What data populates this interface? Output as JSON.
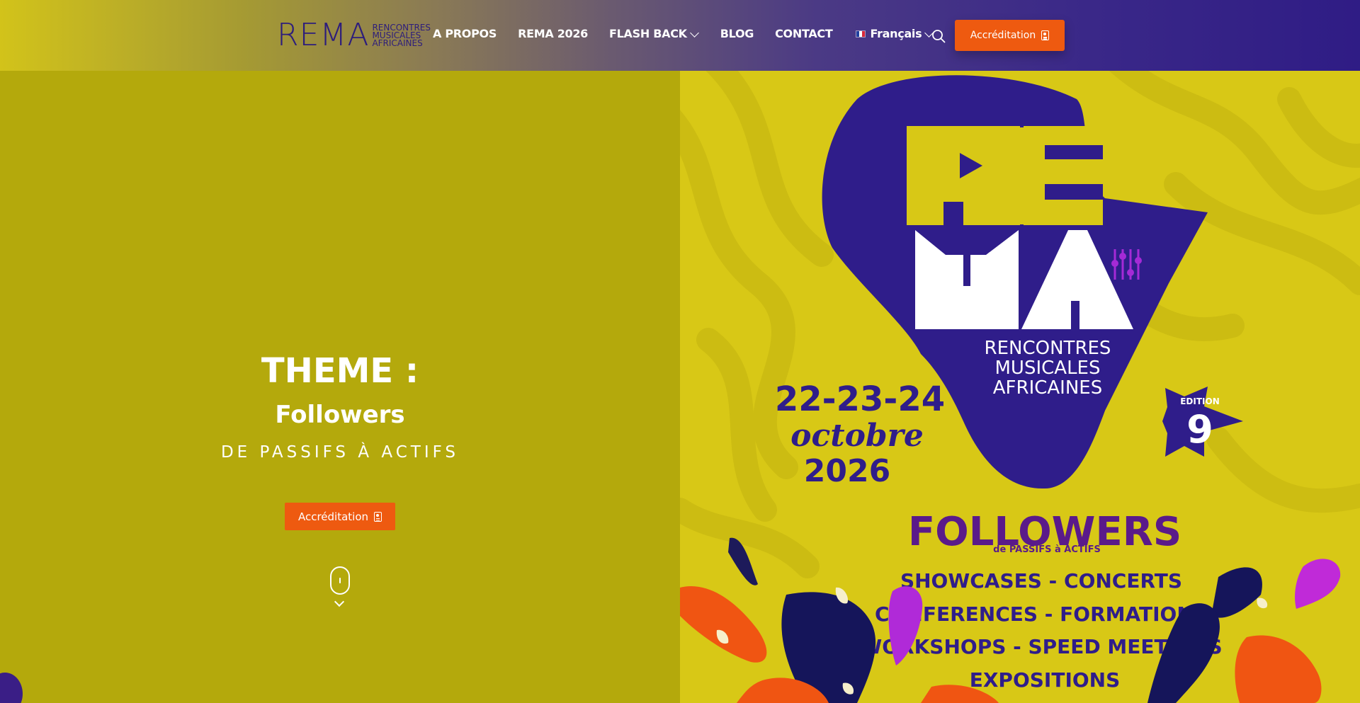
{
  "header": {
    "logo": {
      "mark": "REMA",
      "sub_lines": [
        "RENCONTRES",
        "MUSICALES",
        "AFRICAINES"
      ]
    },
    "nav": [
      {
        "label": "A PROPOS",
        "dropdown": false
      },
      {
        "label": "REMA 2026",
        "dropdown": false
      },
      {
        "label": "FLASH BACK",
        "dropdown": true
      },
      {
        "label": "BLOG",
        "dropdown": false
      },
      {
        "label": "CONTACT",
        "dropdown": false
      }
    ],
    "language": {
      "label": "Français",
      "flag": "fr-flag-icon"
    },
    "search_icon": "search-icon",
    "cta_label": "Accréditation"
  },
  "hero": {
    "title": "THEME :",
    "subtitle": "Followers",
    "tagline": "DE PASSIFS À ACTIFS",
    "cta_label": "Accréditation",
    "scroll_icon": "mouse-scroll-icon"
  },
  "poster": {
    "logo_top": "RE",
    "logo_bottom": "MA",
    "org_lines": [
      "RENCONTRES",
      "MUSICALES",
      "AFRICAINES"
    ],
    "dates": "22-23-24",
    "month": "octobre",
    "year": "2026",
    "edition_label": "EDITION",
    "edition_number": "9",
    "theme": "FOLLOWERS",
    "theme_sub": "de PASSIFS à ACTIFS",
    "activities": [
      "SHOWCASES - CONCERTS",
      "CONFERENCES - FORMATIONS",
      "WORKSHOPS - SPEED MEETINGS",
      "EXPOSITIONS"
    ]
  },
  "colors": {
    "accent_orange": "#ee5a10",
    "brand_purple": "#2d1d7c",
    "brand_yellow": "#d8c816",
    "hero_olive": "#b4a90c"
  }
}
